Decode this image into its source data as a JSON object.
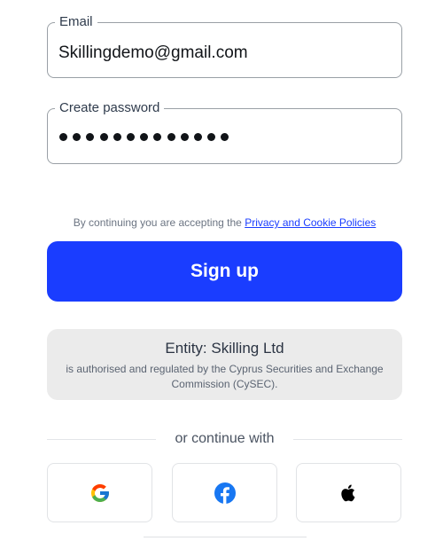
{
  "form": {
    "email": {
      "label": "Email",
      "value": "Skillingdemo@gmail.com"
    },
    "password": {
      "label": "Create password",
      "masked_length": 13
    }
  },
  "consent": {
    "text": "By continuing you are accepting the ",
    "link_label": "Privacy and Cookie Policies"
  },
  "signup_button": {
    "label": "Sign up",
    "color": "#1a3dff"
  },
  "entity": {
    "title": "Entity: Skilling Ltd",
    "description": "is authorised and regulated by the Cyprus Securities and Exchange Commission (CySEC)."
  },
  "social": {
    "divider_text": "or continue with",
    "providers": [
      {
        "name": "Google",
        "icon": "google-icon"
      },
      {
        "name": "Facebook",
        "icon": "facebook-icon"
      },
      {
        "name": "Apple",
        "icon": "apple-icon"
      }
    ]
  }
}
